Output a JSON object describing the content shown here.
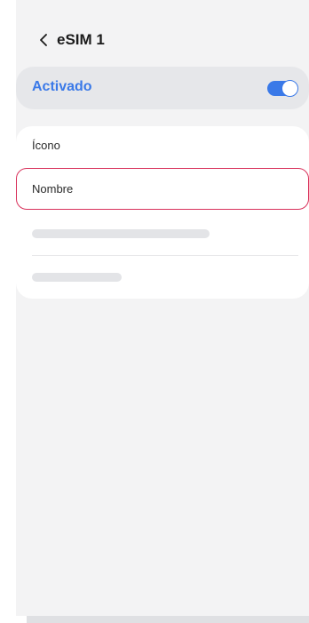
{
  "header": {
    "back_icon": "chevron-left-icon",
    "title": "eSIM 1"
  },
  "toggle": {
    "label": "Activado",
    "enabled": true,
    "accent_color": "#3a79e8"
  },
  "list": {
    "items": [
      {
        "label": "Ícono"
      },
      {
        "label": "Nombre",
        "highlighted": true,
        "highlight_color": "#d8315b"
      }
    ]
  }
}
